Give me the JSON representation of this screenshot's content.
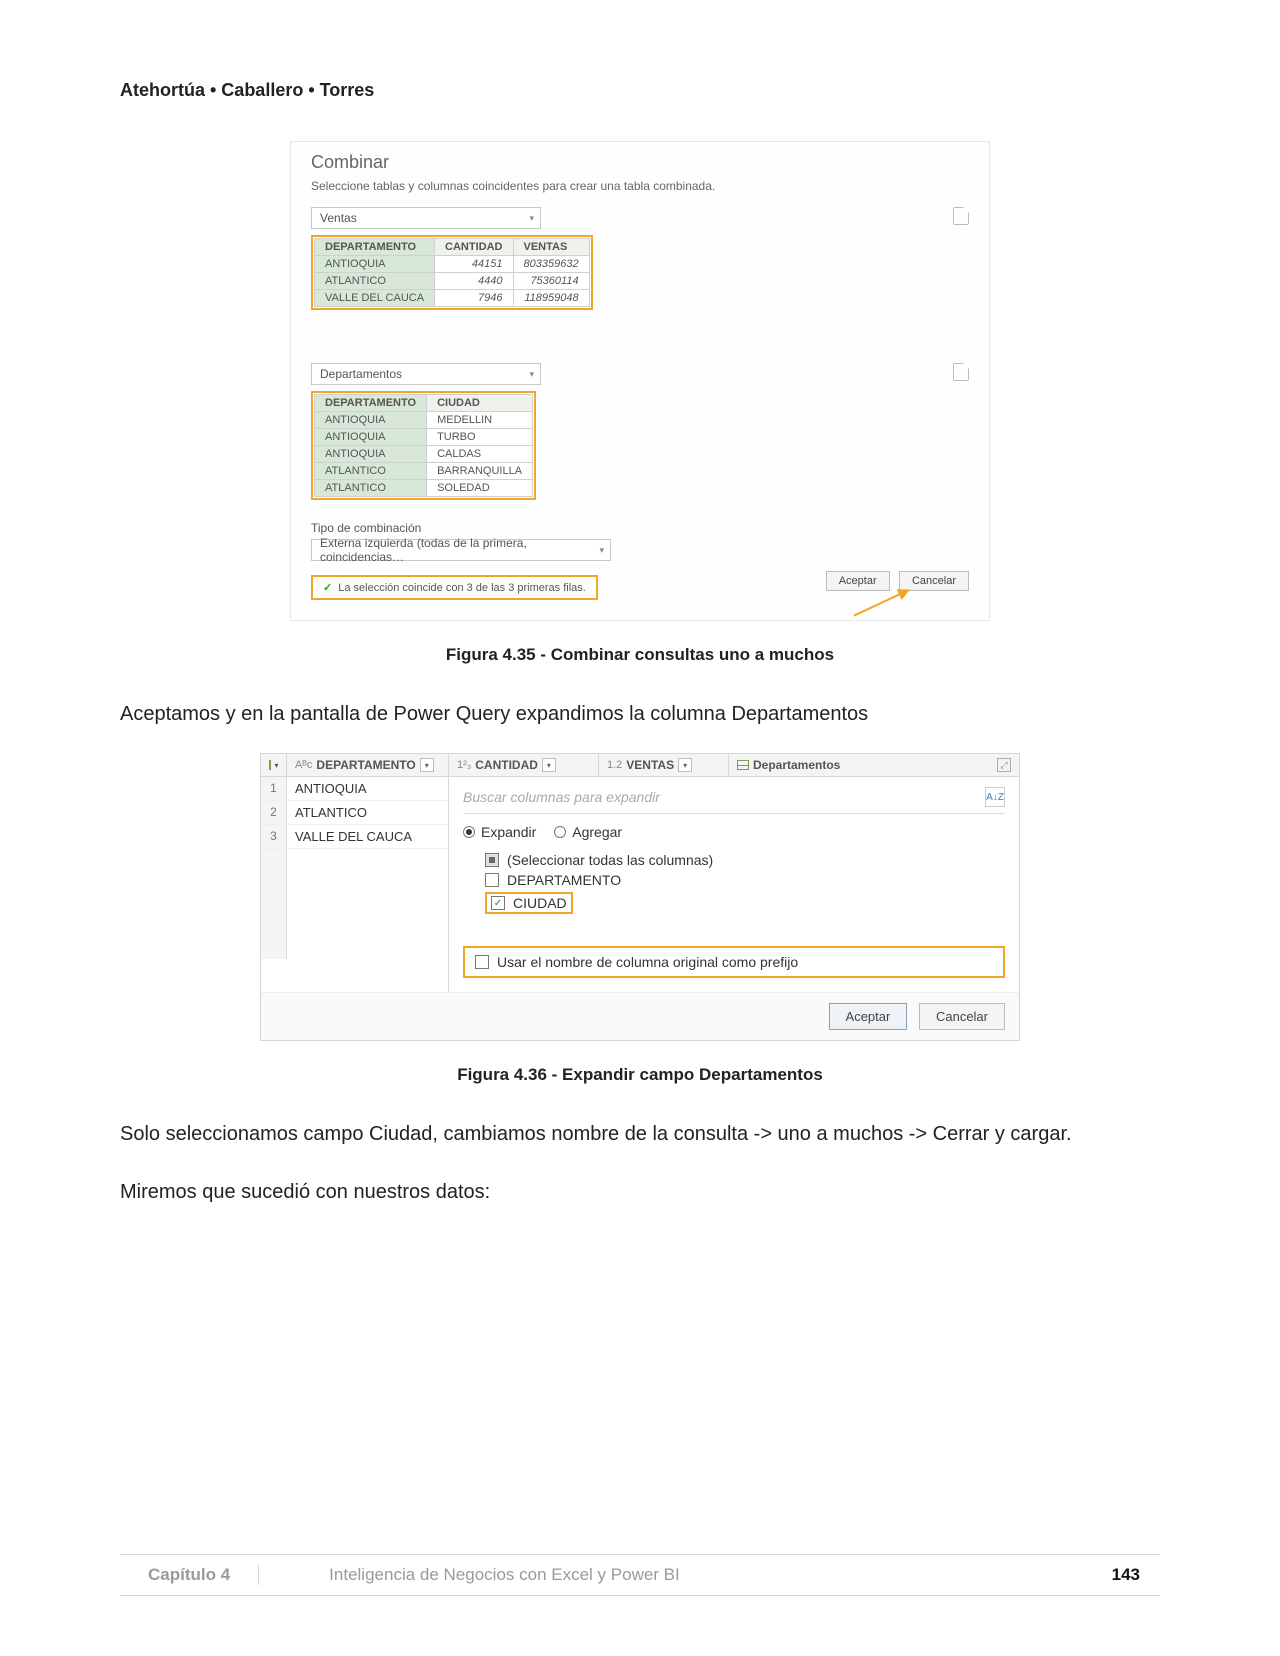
{
  "header": {
    "authors": "Atehortúa • Caballero • Torres"
  },
  "fig1": {
    "title": "Combinar",
    "subtitle": "Seleccione tablas y columnas coincidentes para crear una tabla combinada.",
    "dd1": "Ventas",
    "t1_headers": [
      "DEPARTAMENTO",
      "CANTIDAD",
      "VENTAS"
    ],
    "t1_rows": [
      {
        "c0": "ANTIOQUIA",
        "c1": "44151",
        "c2": "803359632"
      },
      {
        "c0": "ATLANTICO",
        "c1": "4440",
        "c2": "75360114"
      },
      {
        "c0": "VALLE DEL CAUCA",
        "c1": "7946",
        "c2": "118959048"
      }
    ],
    "dd2": "Departamentos",
    "t2_headers": [
      "DEPARTAMENTO",
      "CIUDAD"
    ],
    "t2_rows": [
      {
        "c0": "ANTIOQUIA",
        "c1": "MEDELLIN"
      },
      {
        "c0": "ANTIOQUIA",
        "c1": "TURBO"
      },
      {
        "c0": "ANTIOQUIA",
        "c1": "CALDAS"
      },
      {
        "c0": "ATLANTICO",
        "c1": "BARRANQUILLA"
      },
      {
        "c0": "ATLANTICO",
        "c1": "SOLEDAD"
      }
    ],
    "join_label": "Tipo de combinación",
    "join_value": "Externa izquierda (todas de la primera, coincidencias…",
    "match_msg": "La selección coincide con 3 de las 3 primeras filas.",
    "btn_ok": "Aceptar",
    "btn_cancel": "Cancelar"
  },
  "fig1_caption": "Figura 4.35 -  Combinar consultas uno a muchos",
  "para1": "Aceptamos y en la pantalla de Power Query expandimos la columna Departamentos",
  "fig2": {
    "cols": {
      "c1": "DEPARTAMENTO",
      "c2": "CANTIDAD",
      "c3": "VENTAS",
      "c4": "Departamentos",
      "t1": "Aᴮᴄ",
      "t2": "1²₃",
      "t3": "1.2"
    },
    "rows": [
      {
        "n": "1",
        "v": "ANTIOQUIA"
      },
      {
        "n": "2",
        "v": "ATLANTICO"
      },
      {
        "n": "3",
        "v": "VALLE DEL CAUCA"
      }
    ],
    "search_ph": "Buscar columnas para expandir",
    "sort_label": "A↓Z",
    "radio_expand": "Expandir",
    "radio_aggregate": "Agregar",
    "opt_all": "(Seleccionar todas las columnas)",
    "opt_dep": "DEPARTAMENTO",
    "opt_city": "CIUDAD",
    "prefix": "Usar el nombre de columna original como prefijo",
    "btn_ok": "Aceptar",
    "btn_cancel": "Cancelar"
  },
  "fig2_caption": "Figura 4.36 -  Expandir campo Departamentos",
  "para2": "Solo seleccionamos campo Ciudad, cambiamos nombre de la consulta -> uno a muchos -> Cerrar y cargar.",
  "para3": "Miremos que sucedió con nuestros datos:",
  "footer": {
    "chapter": "Capítulo 4",
    "book": "Inteligencia de Negocios con Excel y Power BI",
    "page": "143"
  }
}
